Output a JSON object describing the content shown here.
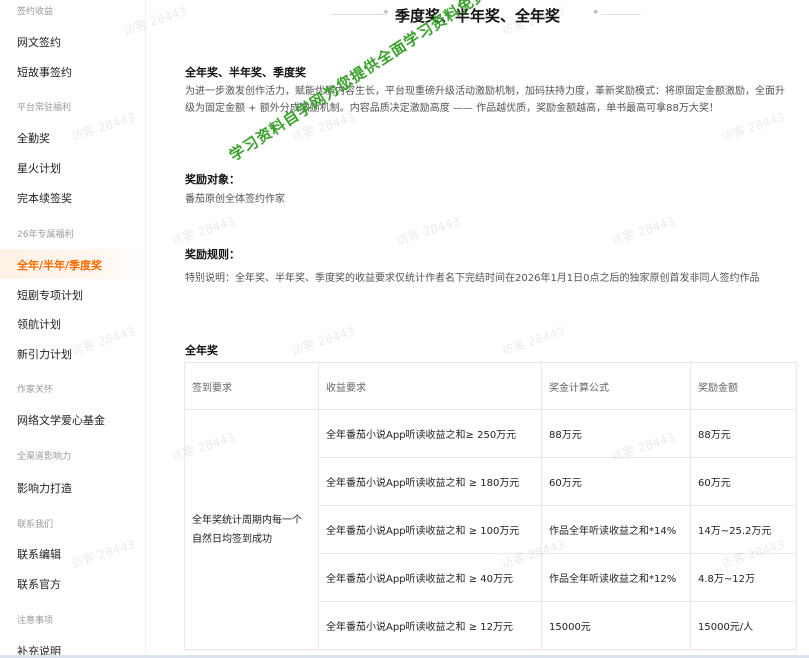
{
  "sidebar": {
    "groups": [
      {
        "title": "签约收益",
        "items": [
          "网文签约",
          "短故事签约"
        ]
      },
      {
        "title": "平台常驻福利",
        "items": [
          "全勤奖",
          "星火计划",
          "完本续签奖"
        ]
      },
      {
        "title": "26年专属福利",
        "items": [
          "全年/半年/季度奖",
          "短剧专项计划",
          "领航计划",
          "新引力计划"
        ]
      },
      {
        "title": "作家关怀",
        "items": [
          "网络文学爱心基金"
        ]
      },
      {
        "title": "全渠道影响力",
        "items": [
          "影响力打造"
        ]
      },
      {
        "title": "联系我们",
        "items": [
          "联系编辑",
          "联系官方"
        ]
      },
      {
        "title": "注意事项",
        "items": [
          "补充说明"
        ]
      }
    ],
    "active_item": "全年/半年/季度奖",
    "active_color": "#ff6a00"
  },
  "main": {
    "page_title": "季度奖、半年奖、全年奖",
    "section1": {
      "heading": "全年奖、半年奖、季度奖",
      "text": "为进一步激发创作活力，赋能优质内容生长，平台现重磅升级活动激励机制，加码扶持力度，革新奖励模式：将原固定金额激励，全面升级为固定金额 + 额外分成激励机制。内容品质决定激励高度 —— 作品越优质，奖励金额越高，单书最高可拿88万大奖！"
    },
    "section2": {
      "heading": "奖励对象：",
      "text": "番茄原创全体签约作家"
    },
    "section3": {
      "heading": "奖励规则：",
      "text": "特别说明：全年奖、半年奖、季度奖的收益要求仅统计作者名下完结时间在2026年1月1日0点之后的独家原创首发非同人签约作品"
    },
    "table_section": {
      "heading": "全年奖",
      "columns": [
        "签到要求",
        "收益要求",
        "奖金计算公式",
        "奖励金额"
      ],
      "merged_requirement": "全年奖统计周期内每一个自然日均签到成功",
      "rows": [
        {
          "income": "全年番茄小说App听读收益之和≥ 250万元",
          "formula": "88万元",
          "amount": "88万元"
        },
        {
          "income": "全年番茄小说App听读收益之和 ≥ 180万元",
          "formula": "60万元",
          "amount": "60万元"
        },
        {
          "income": "全年番茄小说App听读收益之和 ≥ 100万元",
          "formula": "作品全年听读收益之和*14%",
          "amount": "14万~25.2万元"
        },
        {
          "income": "全年番茄小说App听读收益之和 ≥ 40万元",
          "formula": "作品全年听读收益之和*12%",
          "amount": "4.8万~12万"
        },
        {
          "income": "全年番茄小说App听读收益之和 ≥ 12万元",
          "formula": "15000元",
          "amount": "15000元/人"
        }
      ]
    }
  },
  "watermark": {
    "visitor_text": "访客 28443",
    "promo_text": "学习资料自学网为您提供全面学习资料免费资源",
    "promo_color": "#3aa12d"
  }
}
